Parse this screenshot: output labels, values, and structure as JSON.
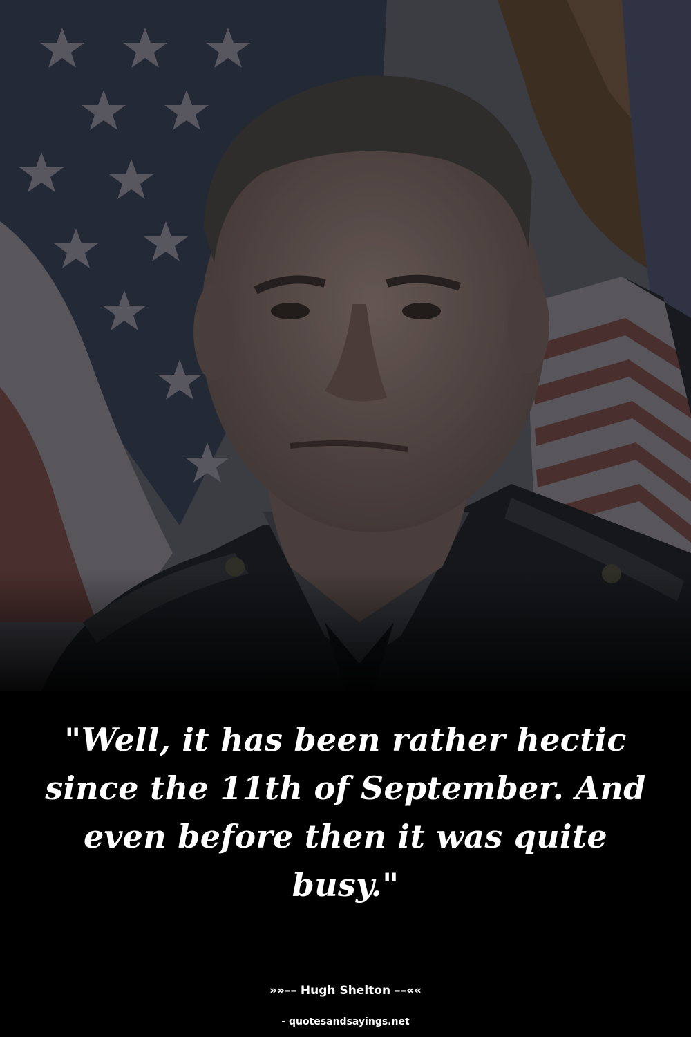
{
  "quote": {
    "text": "\"Well, it has been rather hectic since the 11th of September. And even before then it was quite busy.\""
  },
  "attribution": {
    "author_line": "»»–– Hugh Shelton ––««"
  },
  "source": {
    "text": "- quotesandsayings.net"
  },
  "image": {
    "subject": "portrait-of-man-in-uniform",
    "background": "american-flag",
    "colors": {
      "flag_blue": "#2c3242",
      "flag_red": "#5a3a38",
      "flag_white": "#6c6a70",
      "eagle_gold": "#4a3a2a",
      "skin": "#6a5a56",
      "uniform": "#1a1d22",
      "overlay": "#000000"
    }
  }
}
